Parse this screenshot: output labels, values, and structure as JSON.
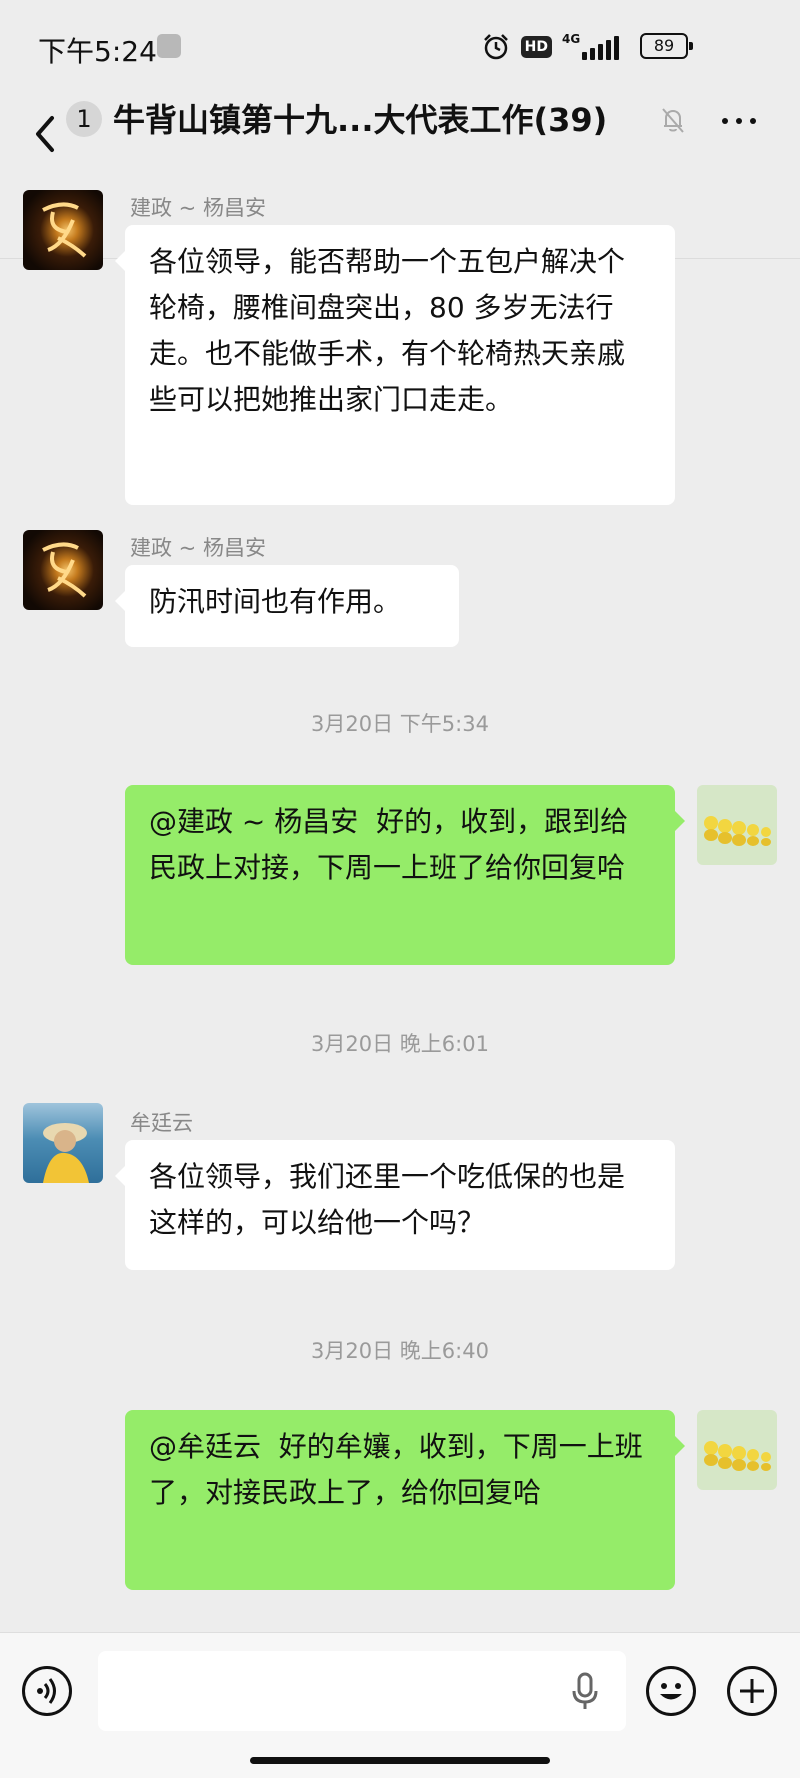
{
  "status_bar": {
    "time": "下午5:24",
    "hd": "HD",
    "network": "4G",
    "battery": "89"
  },
  "nav": {
    "unread_count": "1",
    "title": "牛背山镇第十九...大代表工作(39)"
  },
  "messages": [
    {
      "type": "received",
      "sender": "建政 ~ 杨昌安",
      "text": "各位领导，能否帮助一个五包户解决个轮椅，腰椎间盘突出，80 多岁无法行走。也不能做手术，有个轮椅热天亲戚些可以把她推出家门口走走。"
    },
    {
      "type": "received",
      "sender": "建政 ~ 杨昌安",
      "text": "防汛时间也有作用。"
    },
    {
      "type": "time",
      "text": "3月20日 下午5:34"
    },
    {
      "type": "sent",
      "text": "@建政 ~ 杨昌安  好的，收到，跟到给民政上对接，下周一上班了给你回复哈"
    },
    {
      "type": "time",
      "text": "3月20日 晚上6:01"
    },
    {
      "type": "received",
      "sender": "牟廷云",
      "text": "各位领导，我们还里一个吃低保的也是这样的，可以给他一个吗？"
    },
    {
      "type": "time",
      "text": "3月20日 晚上6:40"
    },
    {
      "type": "sent",
      "text": "@牟廷云  好的牟孃，收到，下周一上班了，对接民政上了，给你回复哈"
    }
  ],
  "input": {
    "placeholder": ""
  },
  "icons": {
    "voice": "voice-icon",
    "mic": "mic-icon",
    "emoji": "emoji-icon",
    "plus": "plus-icon"
  }
}
